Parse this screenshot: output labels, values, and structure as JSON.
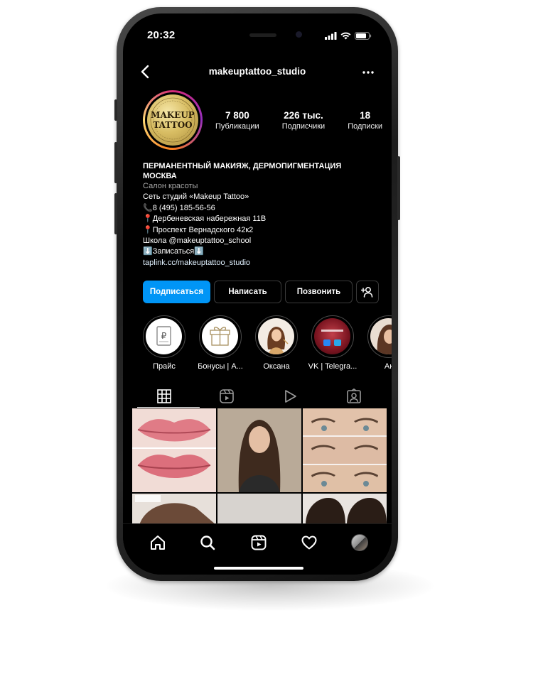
{
  "status": {
    "time": "20:32"
  },
  "header": {
    "username": "makeuptattoo_studio",
    "back_icon": "chevron-left-icon",
    "more_icon": "more-dots-icon"
  },
  "avatar": {
    "logo_line1": "MAKEUP",
    "logo_line2": "TATTOO"
  },
  "stats": [
    {
      "value": "7 800",
      "label": "Публикации"
    },
    {
      "value": "226 тыс.",
      "label": "Подписчики"
    },
    {
      "value": "18",
      "label": "Подписки"
    }
  ],
  "bio": {
    "title_line1": "ПЕРМАНЕНТНЫЙ МАКИЯЖ, ДЕРМОПИГМЕНТАЦИЯ",
    "title_line2": "МОСКВА",
    "category": "Салон красоты",
    "line1": "Сеть студий «Makeup Tattoo»",
    "line2": "📞8 (495) 185-56-56",
    "line3": "📍Дербеневская набережная 11В",
    "line4": "📍Проспект Вернадского 42к2",
    "line5": "Школа @makeuptattoo_school",
    "line6": "⬇️Записаться⬇️",
    "link": "taplink.cc/makeuptattoo_studio"
  },
  "buttons": {
    "follow": "Подписаться",
    "message": "Написать",
    "call": "Позвонить",
    "add_user_icon": "add-user-icon"
  },
  "highlights": [
    {
      "label": "Прайс"
    },
    {
      "label": "Бонусы | А..."
    },
    {
      "label": "Оксана"
    },
    {
      "label": "VK | Telegra..."
    },
    {
      "label": "Ак"
    }
  ],
  "tabs": [
    "grid-icon",
    "reels-icon",
    "video-icon",
    "tagged-icon"
  ],
  "bottom_nav": [
    "home-icon",
    "search-icon",
    "reels-icon",
    "heart-icon",
    "profile-avatar"
  ],
  "colors": {
    "primary_button": "#0095f6",
    "background": "#000000"
  }
}
